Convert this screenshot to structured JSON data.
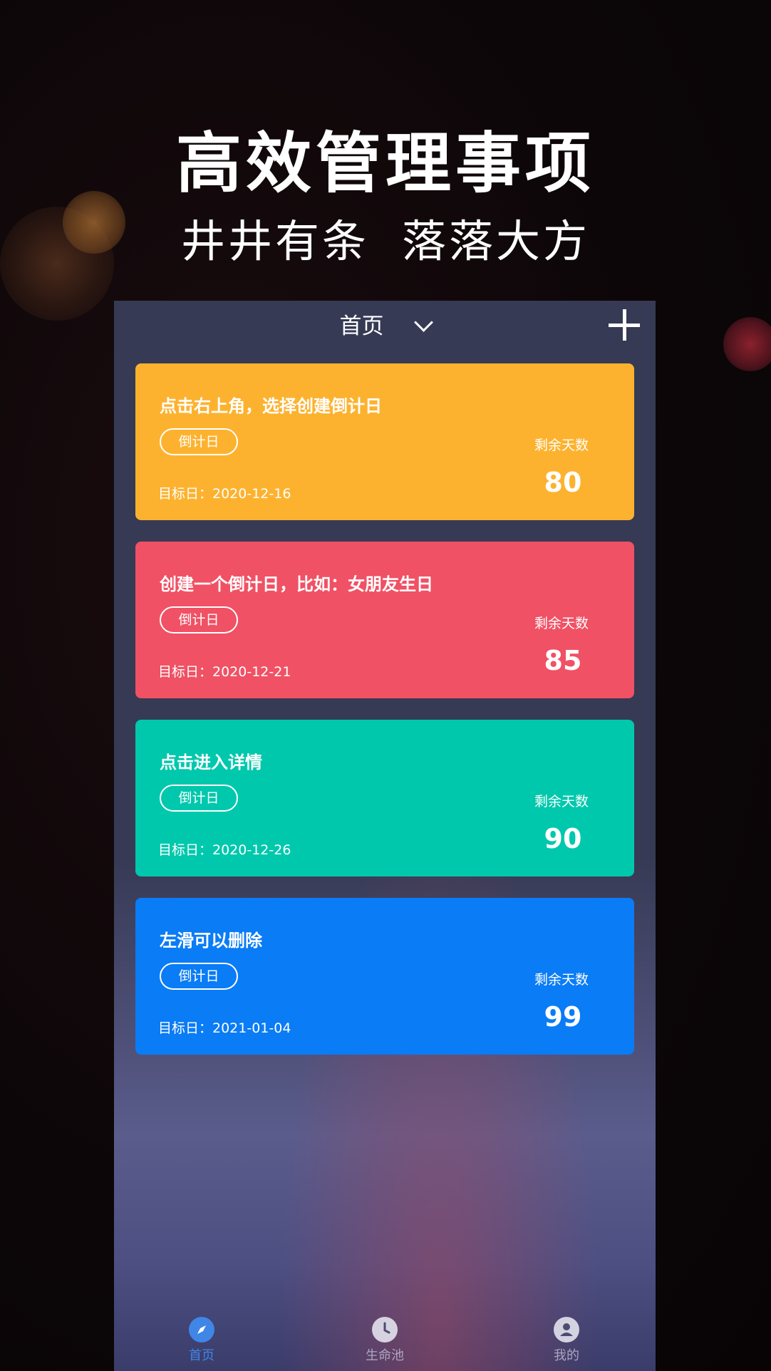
{
  "promo": {
    "headline": "高效管理事项",
    "subline_left": "井井有条",
    "subline_right": "落落大方"
  },
  "header": {
    "title": "首页",
    "add_icon": "plus-icon",
    "dropdown_icon": "chevron-down-icon"
  },
  "cards": [
    {
      "title": "点击右上角，选择创建倒计日",
      "tag": "倒计日",
      "date": "目标日：2020-12-16",
      "remain_label": "剩余天数",
      "days": "80",
      "color": "#fdb22f"
    },
    {
      "title": "创建一个倒计日，比如：女朋友生日",
      "tag": "倒计日",
      "date": "目标日：2020-12-21",
      "remain_label": "剩余天数",
      "days": "85",
      "color": "#f05164"
    },
    {
      "title": "点击进入详情",
      "tag": "倒计日",
      "date": "目标日：2020-12-26",
      "remain_label": "剩余天数",
      "days": "90",
      "color": "#00c8ad"
    },
    {
      "title": "左滑可以删除",
      "tag": "倒计日",
      "date": "目标日：2021-01-04",
      "remain_label": "剩余天数",
      "days": "99",
      "color": "#0a7cf6"
    }
  ],
  "nav": [
    {
      "label": "首页",
      "icon": "compass-icon",
      "active": true
    },
    {
      "label": "生命池",
      "icon": "clock-icon",
      "active": false
    },
    {
      "label": "我的",
      "icon": "user-icon",
      "active": false
    }
  ],
  "colors": {
    "background": "#0b0507",
    "phone_header": "#363a54",
    "nav_active": "#3f86e6"
  }
}
